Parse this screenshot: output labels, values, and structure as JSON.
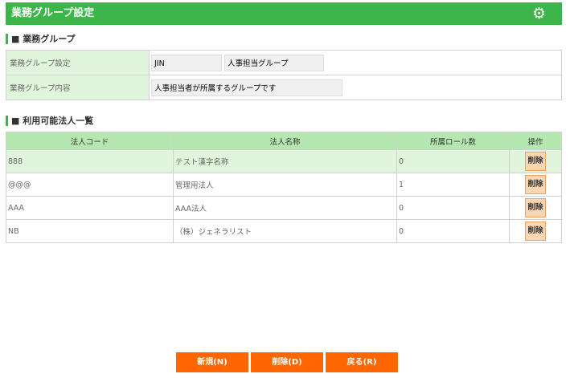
{
  "header": {
    "title": "業務グループ設定",
    "settings_icon": "gear-icon"
  },
  "group_section": {
    "title": "■ 業務グループ",
    "rows": [
      {
        "label": "業務グループ設定",
        "code": "JIN",
        "name": "人事担当グループ"
      },
      {
        "label": "業務グループ内容",
        "value": "人事担当者が所属するグループです"
      }
    ]
  },
  "corp_section": {
    "title": "■ 利用可能法人一覧",
    "columns": [
      "法人コード",
      "法人名称",
      "所属ロール数",
      "操作"
    ],
    "rows": [
      {
        "code": "888",
        "name": "テスト漢字名称",
        "roles": "0",
        "action": "削除"
      },
      {
        "code": "@@@",
        "name": "管理用法人",
        "roles": "1",
        "action": "削除"
      },
      {
        "code": "AAA",
        "name": "AAA法人",
        "roles": "0",
        "action": "削除"
      },
      {
        "code": "NB",
        "name": "（株）ジェネラリスト",
        "roles": "0",
        "action": "削除"
      }
    ]
  },
  "footer": {
    "new": "新規(N)",
    "delete": "削除(D)",
    "back": "戻る(R)"
  }
}
